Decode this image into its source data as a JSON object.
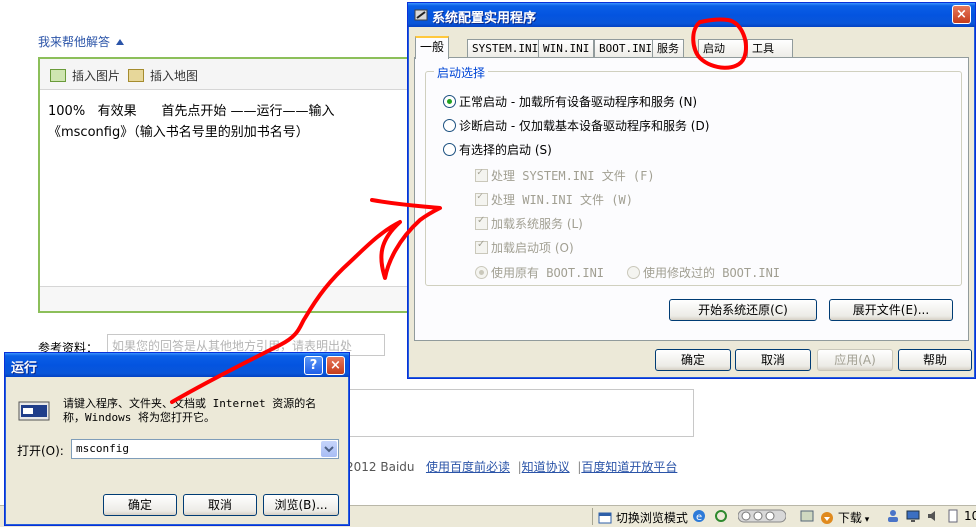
{
  "page": {
    "help_link": "我来帮他解答",
    "insert_image": "插入图片",
    "insert_map": "插入地图",
    "answer_line1": "100%   有效果      首先点开始 ——运行——输入",
    "answer_line2": "《msconfig》（输入书名号里的别加书名号）",
    "reference_label": "参考资料：",
    "reference_placeholder": "如果您的回答是从其他地方引用，请表明出处",
    "footer_copyright": "2012 Baidu",
    "footer_links": [
      "使用百度前必读",
      "知道协议",
      "百度知道开放平台"
    ]
  },
  "statusbar": {
    "switch_mode": "切换浏览模式",
    "download": "下载",
    "zoom_partial": "10"
  },
  "msconfig": {
    "title": "系统配置实用程序",
    "tabs": [
      "一般",
      "SYSTEM.INI",
      "WIN.INI",
      "BOOT.INI",
      "服务",
      "启动",
      "工具"
    ],
    "active_tab": "一般",
    "group_title": "启动选择",
    "radio_normal": "正常启动 - 加载所有设备驱动程序和服务 (N)",
    "radio_diagnostic": "诊断启动 - 仅加载基本设备驱动程序和服务 (D)",
    "radio_selective": "有选择的启动 (S)",
    "check_system_ini": "处理 SYSTEM.INI 文件 (F)",
    "check_win_ini": "处理 WIN.INI 文件 (W)",
    "check_services": "加载系统服务 (L)",
    "check_startup": "加载启动项 (O)",
    "radio_orig_boot": "使用原有 BOOT.INI",
    "radio_mod_boot": "使用修改过的 BOOT.INI",
    "btn_restore": "开始系统还原(C)",
    "btn_expand": "展开文件(E)...",
    "btn_ok": "确定",
    "btn_cancel": "取消",
    "btn_apply": "应用(A)",
    "btn_help": "帮助"
  },
  "run_dialog": {
    "title": "运行",
    "help_btn": "?",
    "close_btn": "×",
    "description_line1": "请键入程序、文件夹、文档或 Internet 资源的名",
    "description_line2": "称，Windows 将为您打开它。",
    "open_label": "打开(O):",
    "open_value": "msconfig",
    "btn_ok": "确定",
    "btn_cancel": "取消",
    "btn_browse": "浏览(B)..."
  },
  "colors": {
    "annotation": "#ff0000",
    "xp_title": "#0454e0",
    "dialog_face": "#ece9d8",
    "link": "#2b54a8",
    "editor_border": "#8cbf5a"
  }
}
